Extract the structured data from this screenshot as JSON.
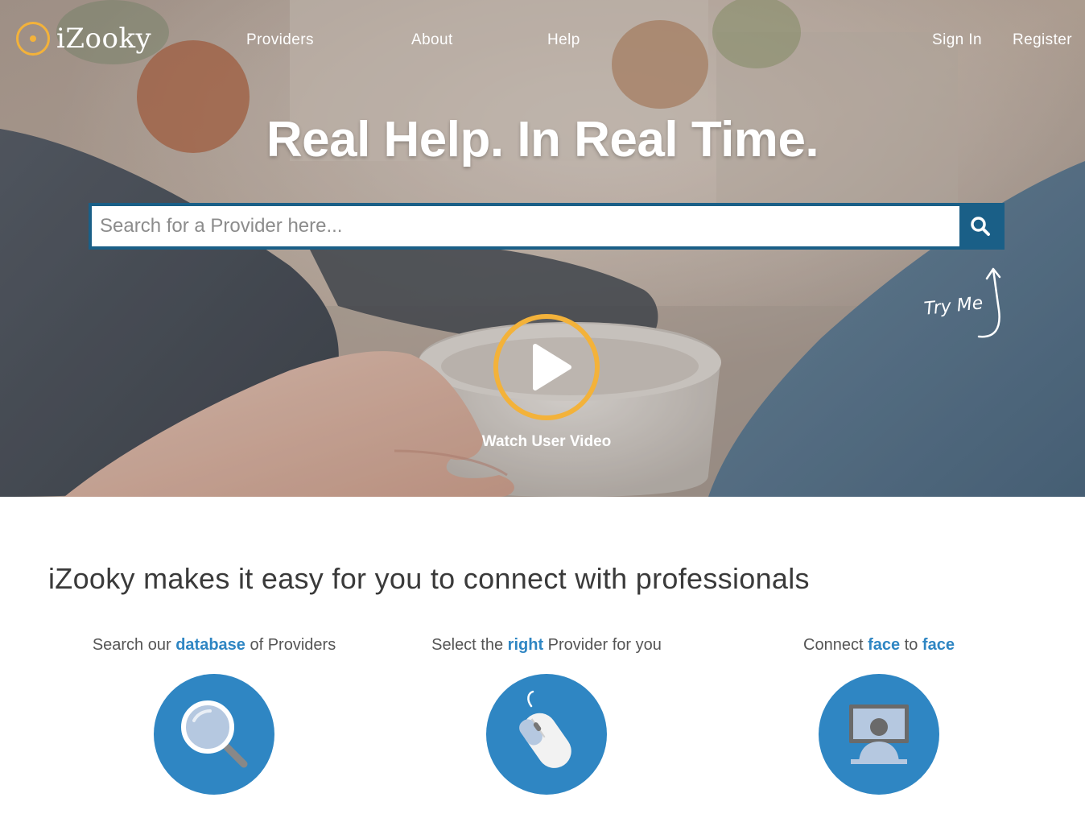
{
  "brand": {
    "name": "iZooky",
    "accent": "#f3b23a"
  },
  "nav": {
    "links": [
      "Providers",
      "About",
      "Help"
    ],
    "sign_in": "Sign In",
    "register": "Register"
  },
  "hero": {
    "title": "Real Help. In Real Time.",
    "search": {
      "placeholder": "Search for a Provider here...",
      "button_icon": "search-icon",
      "color": "#1a5f87"
    },
    "try_me": "Try Me",
    "video_label": "Watch User Video"
  },
  "features": {
    "heading": "iZooky makes it easy for you to connect with professionals",
    "highlight_color": "#2f86c3",
    "items": [
      {
        "pre": "Search our ",
        "hl": "database",
        "post": " of Providers",
        "icon": "magnifier-icon"
      },
      {
        "pre": "Select the ",
        "hl": "right",
        "post": " Provider for you",
        "icon": "mouse-icon"
      },
      {
        "pre": "Connect ",
        "hl": "face",
        "mid": " to ",
        "hl2": "face",
        "icon": "video-monitor-icon"
      }
    ]
  }
}
